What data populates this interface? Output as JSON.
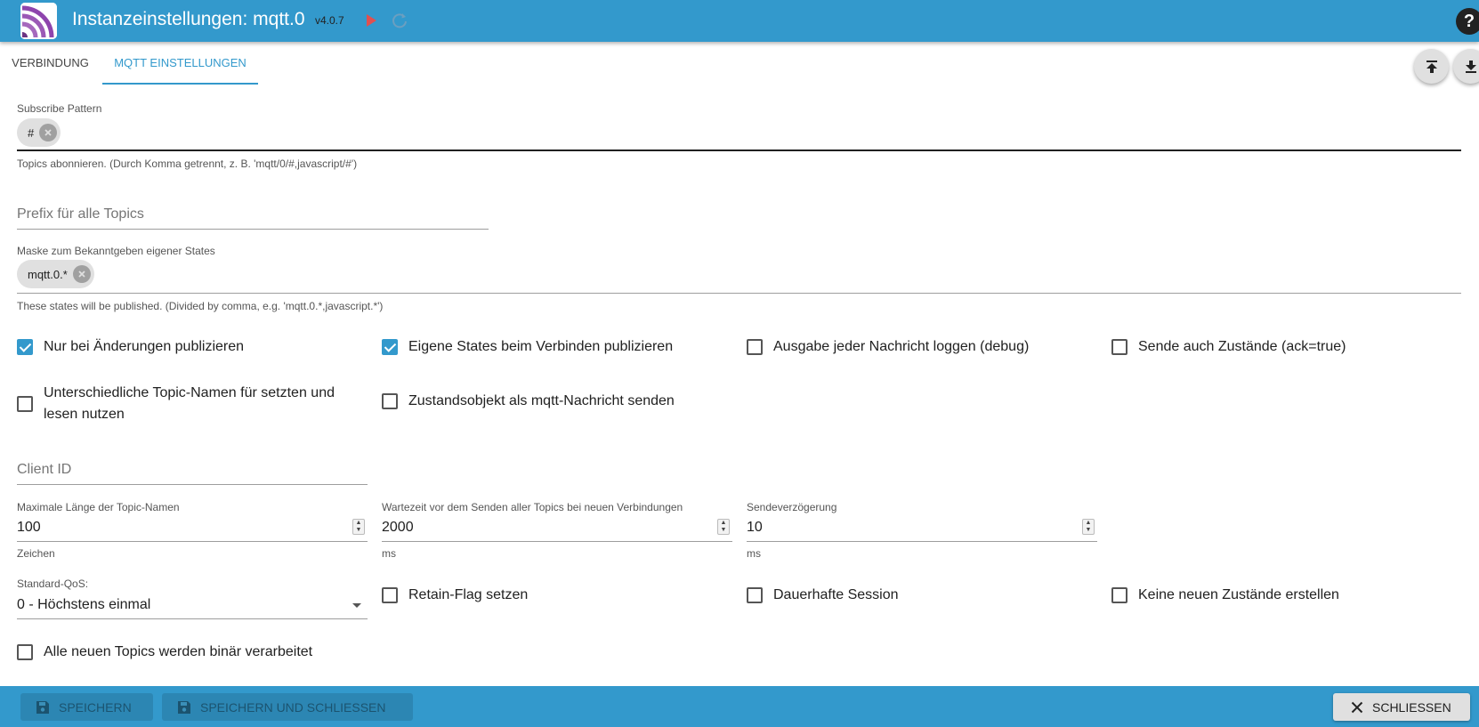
{
  "header": {
    "title": "Instanzeinstellungen: mqtt.0",
    "version": "v4.0.7",
    "colors": {
      "bar": "#3399cc",
      "play": "#e05050"
    }
  },
  "tabs": [
    {
      "label": "Verbindung",
      "active": false
    },
    {
      "label": "MQTT Einstellungen",
      "active": true
    }
  ],
  "subscribe": {
    "label": "Subscribe Pattern",
    "chip": "#",
    "helper": "Topics abonnieren. (Durch Komma getrennt, z. B. 'mqtt/0/#,javascript/#')"
  },
  "prefix": {
    "label": "Prefix für alle Topics"
  },
  "publish_mask": {
    "label": "Maske zum Bekanntgeben eigener States",
    "chip": "mqtt.0.*",
    "helper": "These states will be published. (Divided by comma, e.g. 'mqtt.0.*,javascript.*')"
  },
  "checkboxes_row1": [
    {
      "label": "Nur bei Änderungen publizieren",
      "checked": true
    },
    {
      "label": "Eigene States beim Verbinden publizieren",
      "checked": true
    },
    {
      "label": "Ausgabe jeder Nachricht loggen (debug)",
      "checked": false
    },
    {
      "label": "Sende auch Zustände (ack=true)",
      "checked": false
    }
  ],
  "checkboxes_row2": [
    {
      "label_line1": "Unterschiedliche Topic-Namen für setzten und",
      "label_line2": "lesen nutzen",
      "checked": false
    },
    {
      "label": "Zustandsobjekt als mqtt-Nachricht senden",
      "checked": false
    }
  ],
  "client_id": {
    "label": "Client ID"
  },
  "max_topic_length": {
    "label": "Maximale Länge der Topic-Namen",
    "value": "100",
    "unit": "Zeichen"
  },
  "wait_time": {
    "label": "Wartezeit vor dem Senden aller Topics bei neuen Verbindungen",
    "value": "2000",
    "unit": "ms"
  },
  "send_delay": {
    "label": "Sendeverzögerung",
    "value": "10",
    "unit": "ms"
  },
  "qos": {
    "label": "Standard-QoS:",
    "value": "0 - Höchstens einmal"
  },
  "checkboxes_row3": [
    {
      "label": "Retain-Flag setzen",
      "checked": false
    },
    {
      "label": "Dauerhafte Session",
      "checked": false
    },
    {
      "label": "Keine neuen Zustände erstellen",
      "checked": false
    }
  ],
  "checkbox_binary": {
    "label": "Alle neuen Topics werden binär verarbeitet",
    "checked": false
  },
  "footer": {
    "save": "Speichern",
    "save_close": "Speichern und schließen",
    "close": "Schließen"
  }
}
